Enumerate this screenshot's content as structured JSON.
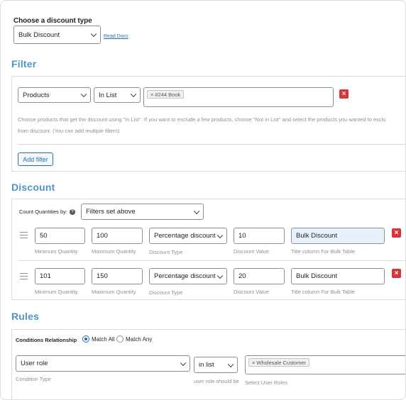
{
  "discount_type": {
    "label": "Choose a discount type",
    "selected": "Bulk Discount",
    "read_docs": "Read Docs"
  },
  "filter": {
    "title": "Filter",
    "type_selected": "Products",
    "method_selected": "In List",
    "tags": [
      "#244 Book"
    ],
    "hint_line1": "Choose products that get the discount using \"In List\". If you want to exclude a few products, choose \"Not in List\" and select the products you wanted to exclu",
    "hint_line2": "from discount. (You can add multiple filters)",
    "add_filter": "Add filter"
  },
  "discount": {
    "title": "Discount",
    "count_label": "Count Quantities by:",
    "count_selected": "Filters set above",
    "field_labels": {
      "min": "Minimum Quantity",
      "max": "Maximum Quantity",
      "type": "Discount Type",
      "value": "Discount Value",
      "title": "Title column For Bulk Table"
    },
    "rows": [
      {
        "min": "50",
        "max": "100",
        "type": "Percentage discount",
        "value": "10",
        "title": "Bulk Discount"
      },
      {
        "min": "101",
        "max": "150",
        "type": "Percentage discount",
        "value": "20",
        "title": "Bulk Discount"
      }
    ]
  },
  "rules": {
    "title": "Rules",
    "relationship_label": "Conditions Relationship",
    "match_all": "Match All",
    "match_any": "Match Any",
    "condition_type_selected": "User role",
    "condition_type_label": "Condition Type",
    "operator_selected": "in list",
    "operator_label": "user role should be",
    "tags": [
      "Wholesale Customer"
    ],
    "values_label": "Select User Roles"
  },
  "colors": {
    "accent": "#4f94c9",
    "link": "#2271b1",
    "danger": "#d63638",
    "focused_input": "#e8f0fe"
  },
  "icons": {
    "remove": "close-icon",
    "drag": "drag-handle-icon",
    "help": "help-icon",
    "dropdown": "chevron-down-icon"
  }
}
